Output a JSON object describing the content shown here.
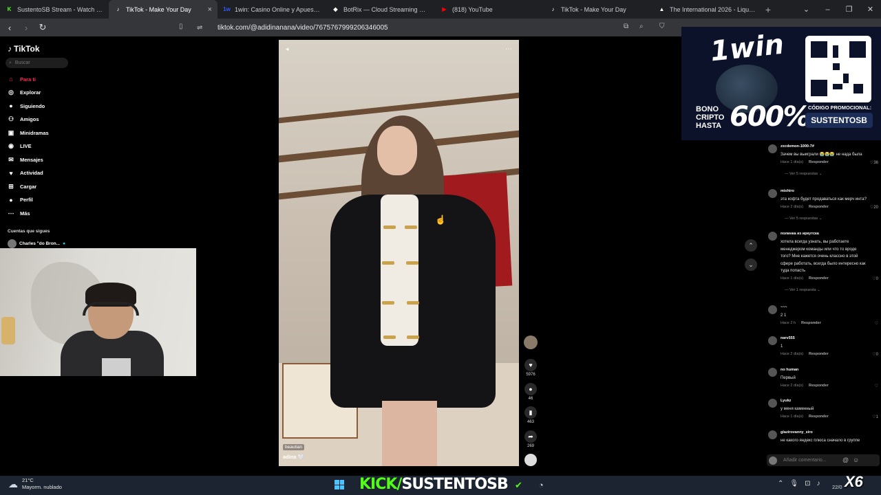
{
  "browser": {
    "tabs": [
      {
        "title": "SustentoSB Stream - Watch Live",
        "color": "#53fc18",
        "glyph": "K"
      },
      {
        "title": "TikTok - Make Your Day",
        "color": "#ffffff",
        "glyph": "♪"
      },
      {
        "title": "1win: Casino Online y Apuestas Dep",
        "color": "#2b5cff",
        "glyph": "1w"
      },
      {
        "title": "BotRix — Cloud Streaming Bot for",
        "color": "#ffffff",
        "glyph": "◆"
      },
      {
        "title": "(818) YouTube",
        "color": "#ff0000",
        "glyph": "▶"
      },
      {
        "title": "TikTok - Make Your Day",
        "color": "#ffffff",
        "glyph": "♪"
      },
      {
        "title": "The International 2026 - Liquipedia",
        "color": "#ffffff",
        "glyph": "▲"
      }
    ],
    "url": "tiktok.com/@adidinanana/video/7675767999206346005"
  },
  "sidebar": {
    "logo": "TikTok",
    "search_placeholder": "Buscar",
    "items": [
      {
        "label": "Para ti",
        "icon": "home-icon",
        "glyph": "⌂",
        "active": true
      },
      {
        "label": "Explorar",
        "icon": "compass-icon",
        "glyph": "◎",
        "active": false
      },
      {
        "label": "Siguiendo",
        "icon": "following-avatar-icon",
        "glyph": "●",
        "active": false
      },
      {
        "label": "Amigos",
        "icon": "friends-icon",
        "glyph": "⚇",
        "active": false
      },
      {
        "label": "Minidramas",
        "icon": "minidrama-icon",
        "glyph": "▣",
        "active": false
      },
      {
        "label": "LIVE",
        "icon": "live-icon",
        "glyph": "◉",
        "active": false
      },
      {
        "label": "Mensajes",
        "icon": "messages-icon",
        "glyph": "✉",
        "active": false
      },
      {
        "label": "Actividad",
        "icon": "activity-icon",
        "glyph": "♥",
        "active": false
      },
      {
        "label": "Cargar",
        "icon": "upload-icon",
        "glyph": "⊞",
        "active": false
      },
      {
        "label": "Perfil",
        "icon": "profile-icon",
        "glyph": "●",
        "active": false
      },
      {
        "label": "Más",
        "icon": "more-icon",
        "glyph": "⋯",
        "active": false
      }
    ],
    "following_header": "Cuentas que sigues",
    "following_first": "Charles \"do Bron..."
  },
  "video": {
    "username": "adina 🤍",
    "tag": "beautian"
  },
  "actions": {
    "likes": "5976",
    "comments": "46",
    "saves": "463",
    "shares": "269"
  },
  "ad": {
    "brand": "1win",
    "bono": [
      "BONO",
      "CRIPTO",
      "HASTA"
    ],
    "percent": "600%",
    "code_label": "CÓDIGO PROMOCIONAL:",
    "code": "SUSTENTOSB"
  },
  "comments": [
    {
      "user": "zxcdemon-1000-7#",
      "lines": [
        "Зачем вы выиграли 😭😭😭 не нада была"
      ],
      "meta": "Hace 1 día(s)",
      "reply": "Responder",
      "likes": "36",
      "more": "Ver 5 respuestas"
    },
    {
      "user": "mishiro",
      "lines": [
        "эта кофта будет продаваться как мерч инта?"
      ],
      "meta": "Hace 2 día(s)",
      "reply": "Responder",
      "likes": "20",
      "more": "Ver 5 respuestas"
    },
    {
      "user": "полинка из иркутска",
      "lines": [
        "хотела всегда узнать, вы работаете",
        "менеджером команды или что то вроде",
        "того? Мне кажется очень классно в этой",
        "сфере работать, всегда было интересно как",
        "туда попасть"
      ],
      "meta": "Hace 1 día(s)",
      "reply": "Responder",
      "likes": "0",
      "more": "Ver 1 respuesta"
    },
    {
      "user": "~~~",
      "lines": [
        "2 1"
      ],
      "meta": "Hace 2 h",
      "reply": "Responder",
      "likes": "",
      "more": ""
    },
    {
      "user": "narv555",
      "lines": [
        "1"
      ],
      "meta": "Hace 2 día(s)",
      "reply": "Responder",
      "likes": "0",
      "more": ""
    },
    {
      "user": "no human",
      "lines": [
        "Первый"
      ],
      "meta": "Hace 2 día(s)",
      "reply": "Responder",
      "likes": "",
      "more": ""
    },
    {
      "user": "Lyukz",
      "lines": [
        "у меня каменный"
      ],
      "meta": "Hace 1 día(s)",
      "reply": "Responder",
      "likes": "1",
      "more": ""
    },
    {
      "user": "glazirovanny_siro",
      "lines": [
        "не какого яндекс плюса сначало в группе"
      ],
      "meta": "",
      "reply": "",
      "likes": "",
      "more": ""
    }
  ],
  "comment_input_placeholder": "Añadir comentario...",
  "taskbar": {
    "temp": "21°C",
    "weather": "Mayorm. nublado",
    "kick_prefix": "KICK/",
    "kick_name": "SUSTENTOSB",
    "overlay": "X6",
    "clock": "22/0"
  }
}
